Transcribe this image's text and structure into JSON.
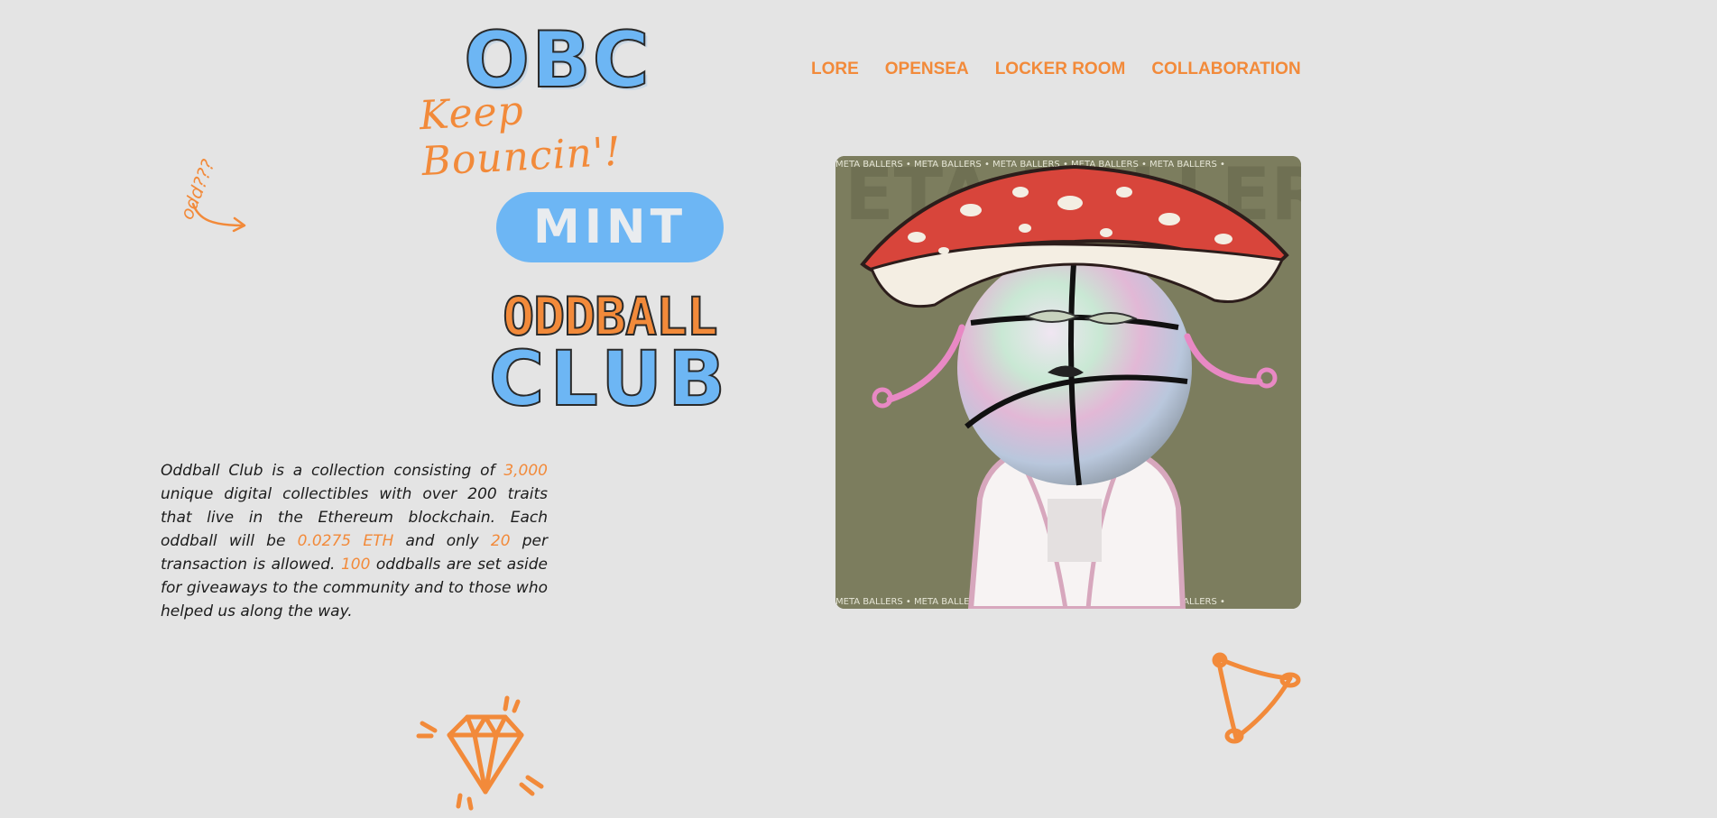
{
  "header": {
    "logo": {
      "acronym": "OBC",
      "tagline": "Keep Bouncin'!"
    },
    "nav": [
      {
        "label": "LORE"
      },
      {
        "label": "OPENSEA"
      },
      {
        "label": "LOCKER ROOM"
      },
      {
        "label": "COLLABORATION"
      }
    ]
  },
  "doodle": {
    "odd_text": "odd???"
  },
  "hero": {
    "mint_label": "MINT",
    "club_logo": {
      "line1": "ODDBALL",
      "line2": "CLUB"
    }
  },
  "description": {
    "p1": "Oddball Club is a collection consisting of ",
    "supply": "3,000",
    "p2": " unique digital collectibles with over 200 traits that live in the Ethereum blockchain. Each oddball will be ",
    "price": "0.0275 ETH",
    "p3": " and only ",
    "per_tx": "20",
    "p4": " per transaction is allowed. ",
    "giveaway": "100",
    "p5": " oddballs are set aside for giveaways to the community and to those who helped us along the way."
  },
  "nft_image": {
    "banner_text": "META BALLERS • META BALLERS • META BALLERS • META BALLERS • META BALLERS •"
  },
  "colors": {
    "background": "#e4e4e4",
    "accent_orange": "#f28a3a",
    "accent_blue": "#6db6f4",
    "text": "#1c1c1c"
  },
  "icons": [
    "arrow-doodle-icon",
    "diamond-icon",
    "megaphone-icon"
  ]
}
